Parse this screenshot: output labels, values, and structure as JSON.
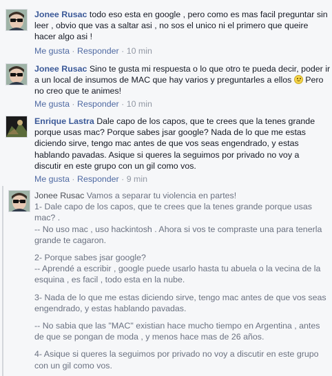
{
  "comments": [
    {
      "author": "Jonee Rusac",
      "text": "todo eso esta en google , pero como es mas facil preguntar sin leer , obvio que vas a saltar asi , no sos el unico ni el primero que queire hacer algo asi !",
      "like": "Me gusta",
      "reply": "Responder",
      "time": "10 min"
    },
    {
      "author": "Jonee Rusac",
      "text": "Sino te gusta mi respuesta o lo que otro te pueda decir, poder ir a un local de insumos de MAC que hay varios y preguntarles a ellos",
      "emoji": "smile-emoji-icon",
      "text_after": "Pero no creo que te animes!",
      "like": "Me gusta",
      "reply": "Responder",
      "time": "10 min"
    },
    {
      "author": "Enrique Lastra",
      "text": "Dale capo de los capos, que te crees que la tenes grande porque usas mac? Porque sabes jsar google? Nada de lo que me estas diciendo sirve, tengo mac antes de que vos seas engendrado, y estas hablando pavadas. Asique si queres la seguimos por privado no voy a discutir en este grupo con un gil como vos.",
      "like": "Me gusta",
      "reply": "Responder",
      "time": "9 min"
    }
  ],
  "reply": {
    "author": "Jonee Rusac",
    "intro": "Vamos a separar tu violencia en partes!",
    "p1a": "1- Dale capo de los capos, que te crees que la tenes grande porque usas mac? .",
    "p1b": "-- No uso mac , uso hackintosh . Ahora si vos te compraste una para tenerla grande te cagaron.",
    "p2a": "2- Porque sabes jsar google?",
    "p2b": "-- Aprendé a escribir , google puede usarlo hasta tu abuela o la vecina de la esquina , es facil , todo esta en la nube.",
    "p3a": "3- Nada de lo que me estas diciendo sirve, tengo mac antes de que vos seas engendrado, y estas hablando pavadas.",
    "p3b": "-- No sabia que las \"MAC\" existian hace mucho tiempo en Argentina , antes de que se pongan de moda , y menos hace mas de 26 años.",
    "p4a": "4- Asique si queres la seguimos por privado no voy a discutir en este grupo con un gil como vos."
  },
  "separator": "·",
  "colors": {
    "link": "#3b5998",
    "meta": "#9197a3",
    "background": "#f6f7f9"
  }
}
